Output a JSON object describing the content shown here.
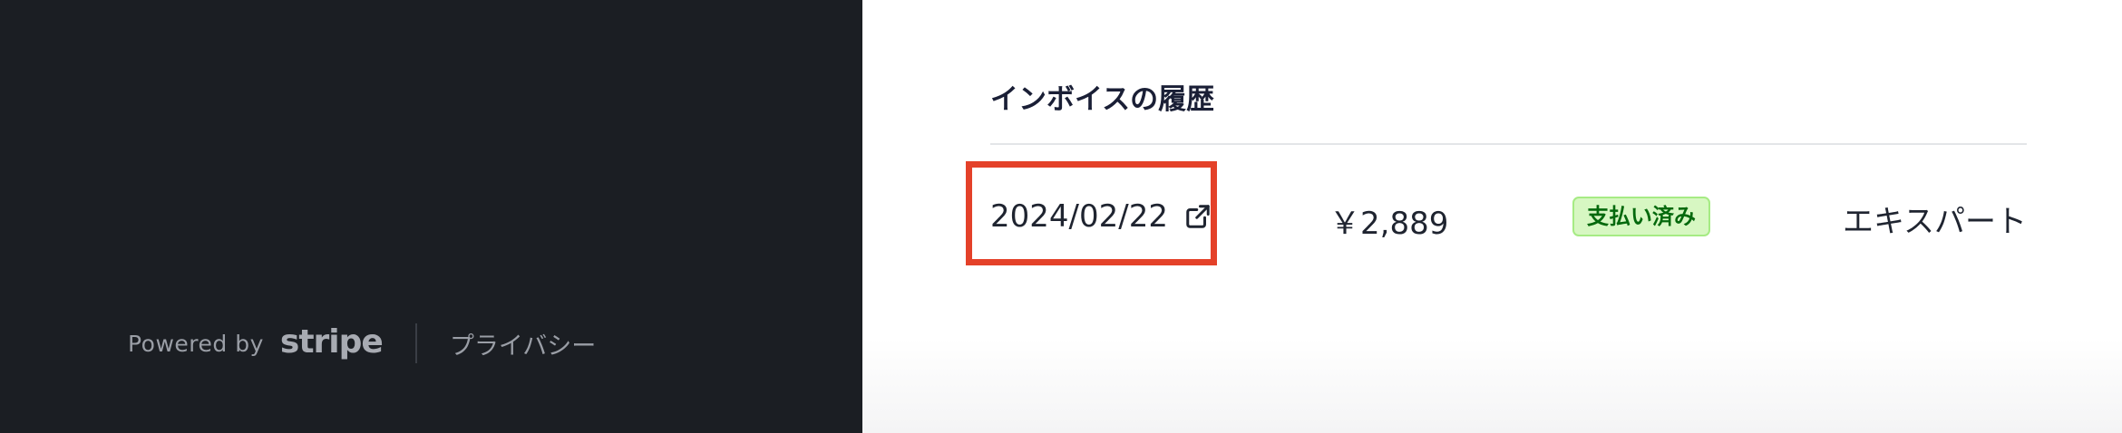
{
  "footer": {
    "powered_by": "Powered by",
    "brand": "stripe",
    "privacy": "プライバシー"
  },
  "invoice_history": {
    "title": "インボイスの履歴",
    "rows": [
      {
        "date": "2024/02/22",
        "amount": "￥2,889",
        "status": "支払い済み",
        "plan": "エキスパート"
      }
    ]
  },
  "colors": {
    "left_panel_bg": "#1b1e23",
    "highlight": "#e44129",
    "badge_bg": "#d7f7c2",
    "badge_text": "#05690d"
  },
  "icons": {
    "date_link_icon": "external-link-icon"
  }
}
